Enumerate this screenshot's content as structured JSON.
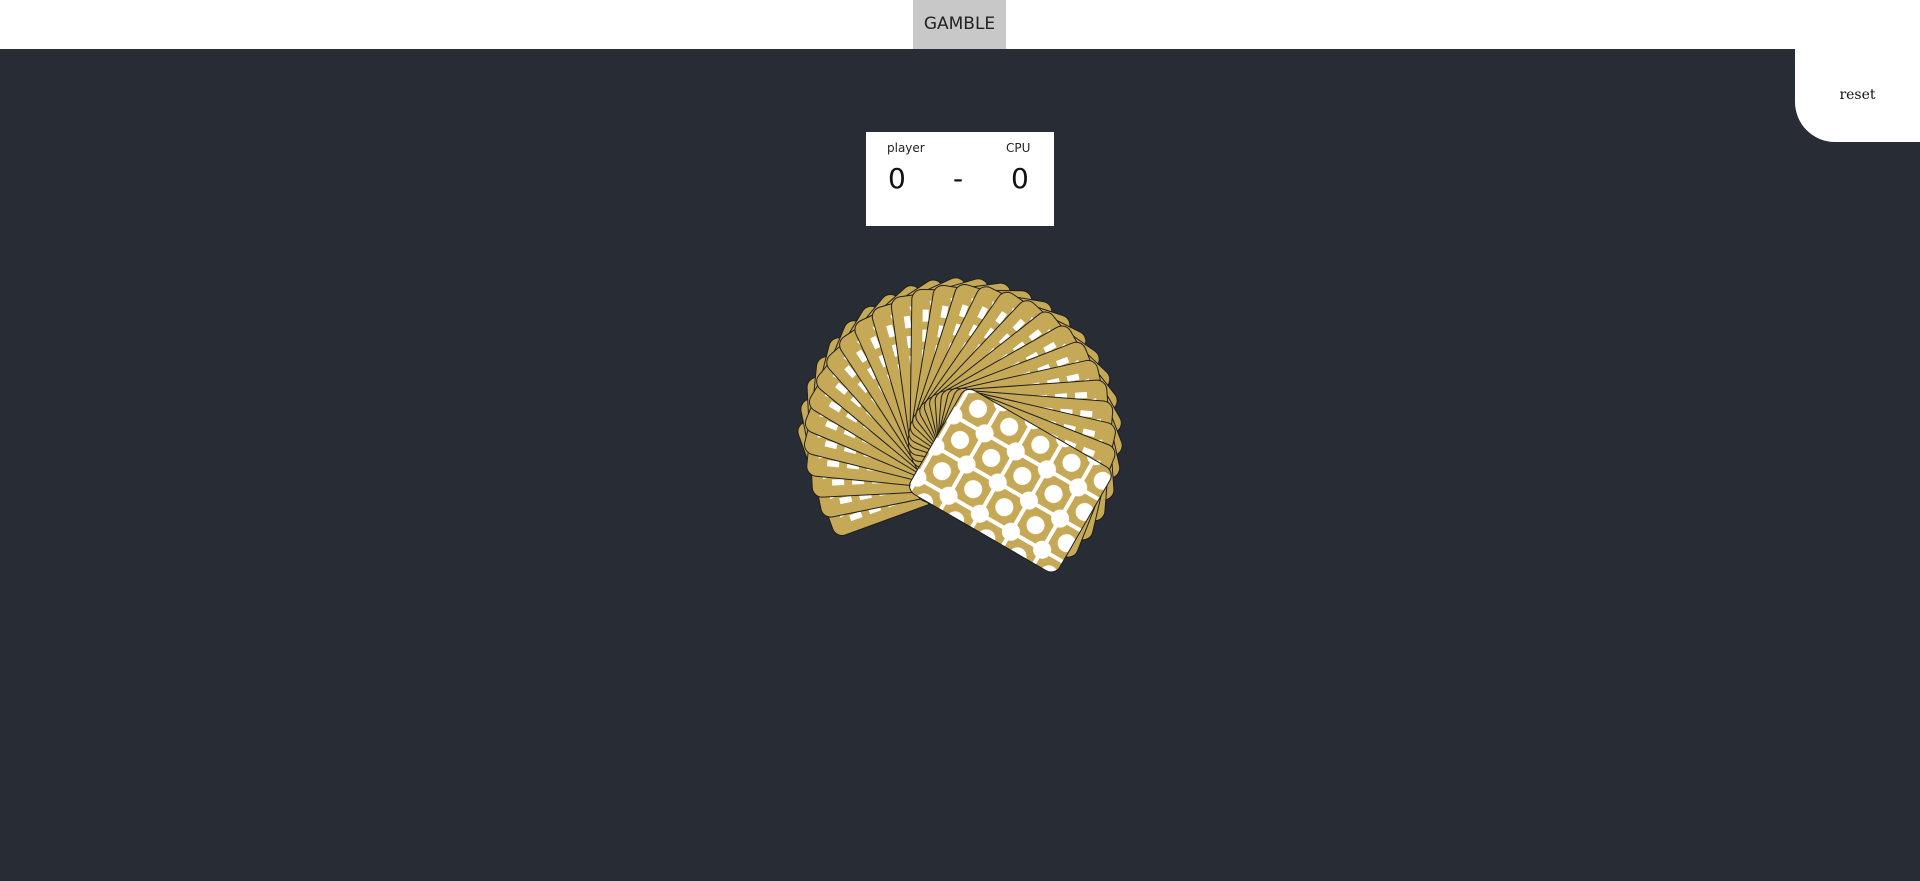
{
  "header": {
    "gamble_label": "GAMBLE"
  },
  "controls": {
    "reset_label": "reset"
  },
  "scoreboard": {
    "player_label": "player",
    "cpu_label": "CPU",
    "player_score": "0",
    "separator": "-",
    "cpu_score": "0"
  },
  "deck": {
    "card_count": 28,
    "card_back_color": "#c6a956",
    "card_pattern_color": "#ffffff",
    "card_edge_color": "#1e1e1e"
  },
  "colors": {
    "table": "#282c35",
    "gamble_button": "#c8c8c8",
    "panel": "#ffffff"
  }
}
